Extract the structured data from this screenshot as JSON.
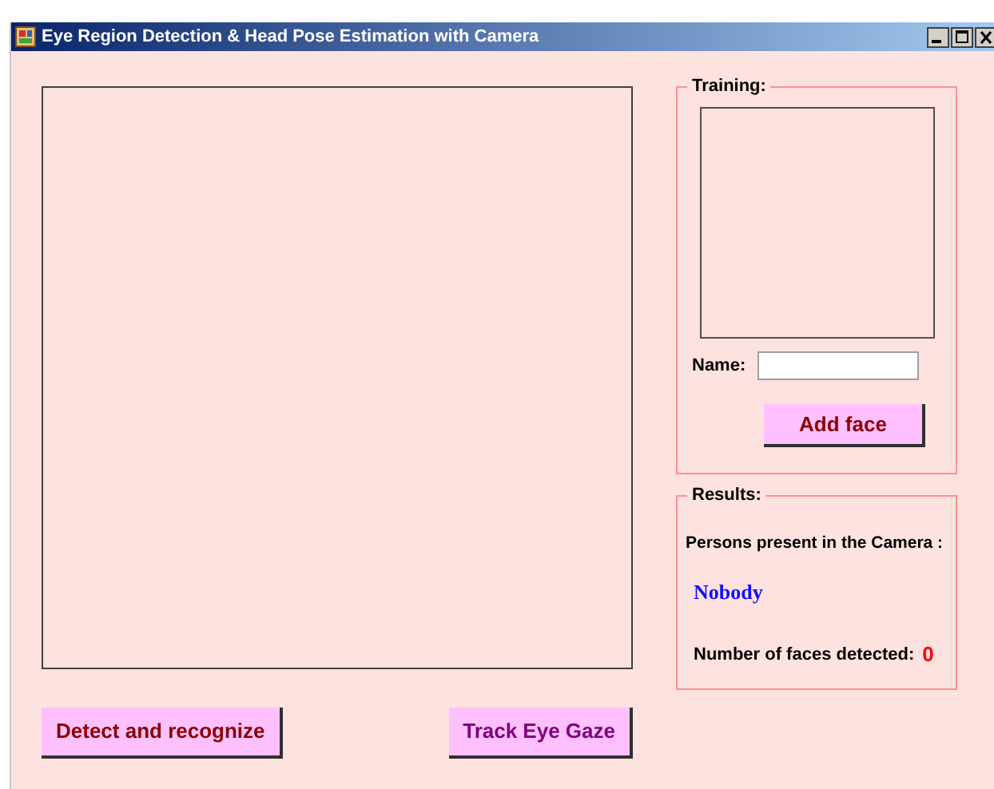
{
  "window": {
    "title": "Eye Region Detection & Head Pose Estimation with Camera"
  },
  "training": {
    "title": "Training:",
    "name_label": "Name:",
    "add_button": "Add face"
  },
  "results": {
    "title": "Results:",
    "persons_label": "Persons present in the Camera :",
    "persons_value": "Nobody",
    "faces_label": "Number of faces detected:",
    "faces_value": "0"
  },
  "buttons": [
    {
      "label": "Detect and recognize",
      "kind": "detect"
    },
    {
      "label": "Track Eye Gaze",
      "kind": "track"
    }
  ]
}
